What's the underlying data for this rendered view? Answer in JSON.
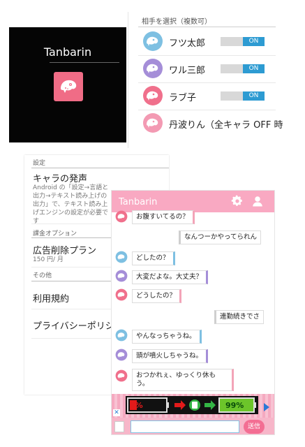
{
  "launcher": {
    "app_name": "Tanbarin",
    "icon": "chameleon-icon",
    "icon_bg": "#f06c86"
  },
  "partners": {
    "title": "相手を選択（複数可）",
    "items": [
      {
        "name": "フツ太郎",
        "toggle": "ON",
        "avatar": "blue-chameleon-avatar",
        "color": "#7ec0e2"
      },
      {
        "name": "ワル三郎",
        "toggle": "ON",
        "avatar": "purple-chameleon-avatar",
        "color": "#a58ed8"
      },
      {
        "name": "ラブ子",
        "toggle": "ON",
        "avatar": "pink-chameleon-avatar",
        "color": "#f0708c"
      },
      {
        "name": "丹波りん（全キャラ OFF 時",
        "toggle": "",
        "avatar": "pink-chameleon-avatar",
        "color": "#f39ab3"
      }
    ]
  },
  "settings": {
    "header": "設定",
    "voice_title": "キャラの発声",
    "voice_desc": "Android の「設定→言語と出力→テキスト読み上げの出力」で、テキスト読み上げエンジンの設定が必要です",
    "billing_header": "課金オプション",
    "ad_plan_title": "広告削除プラン",
    "ad_plan_price": "150 円/ 月",
    "other_header": "その他",
    "terms": "利用規約",
    "privacy": "プライバシーポリシ"
  },
  "chat": {
    "title": "Tanbarin",
    "accent": "#f9a9c2",
    "messages": [
      {
        "from": "pink",
        "text": "お腹すいてるの？"
      },
      {
        "from": "user",
        "text": "なんつーかやってられん"
      },
      {
        "from": "blue",
        "text": "どしたの？"
      },
      {
        "from": "purple",
        "text": "大変だよな。大丈夫？"
      },
      {
        "from": "pink",
        "text": "どうしたの？"
      },
      {
        "from": "user",
        "text": "連勤続きでさ"
      },
      {
        "from": "blue",
        "text": "やんなっちゃうね。"
      },
      {
        "from": "purple",
        "text": "頭が噴火しちゃうね。"
      },
      {
        "from": "pink",
        "text": "おつかれぇ、ゆっくり休もう。"
      }
    ],
    "ad": {
      "low_battery": "9%",
      "full_battery": "99%"
    },
    "send_label": "送信",
    "input_value": ""
  }
}
